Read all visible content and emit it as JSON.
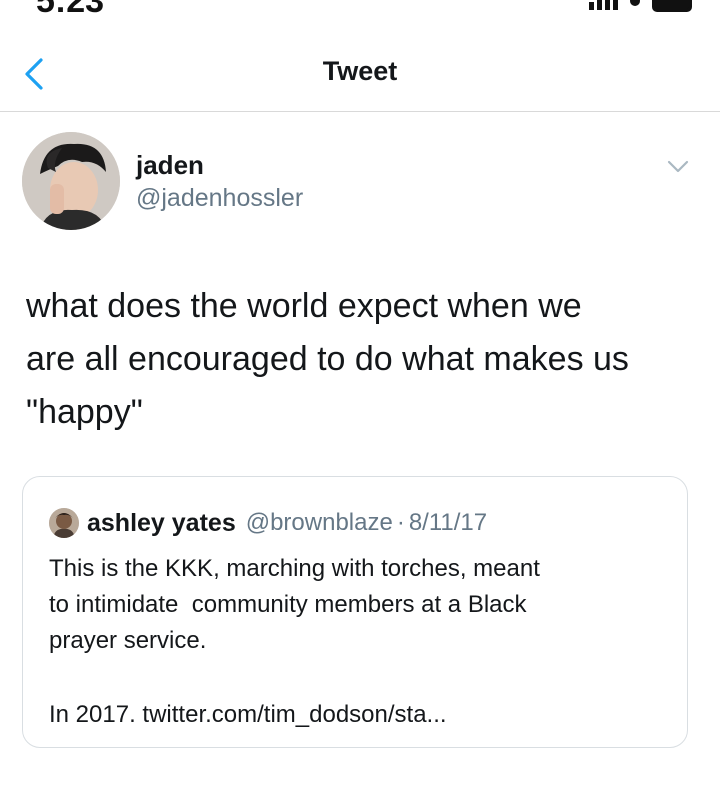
{
  "status_bar": {
    "time": "5:23"
  },
  "nav": {
    "title": "Tweet",
    "back_icon": "chevron-left-icon"
  },
  "tweet": {
    "author_name": "jaden",
    "author_handle": "@jadenhossler",
    "text": "what does the world expect when we\nare all encouraged to do what makes us\n\"happy\"",
    "more_icon": "chevron-down-icon"
  },
  "quote": {
    "author_name": "ashley yates",
    "author_handle": "@brownblaze",
    "separator": "·",
    "date": "8/11/17",
    "text": "This is the KKK, marching with torches, meant\nto intimidate  community members at a Black\nprayer service.",
    "link_prefix": "In 2017.",
    "link_text": "twitter.com/tim_dodson/sta..."
  },
  "colors": {
    "accent": "#1da1f2",
    "secondary_text": "#657786",
    "border": "#d9dee2"
  }
}
